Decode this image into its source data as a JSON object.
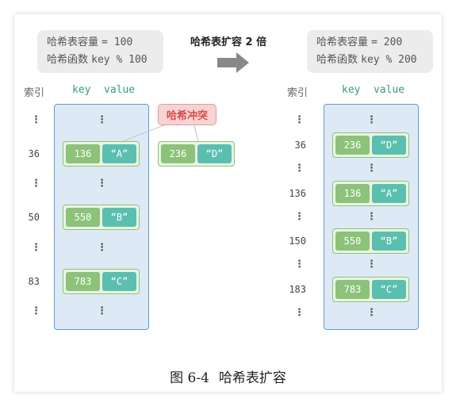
{
  "left_info": {
    "line1_label": "哈希表容量",
    "line1_value": "= 100",
    "line2_label": "哈希函数",
    "line2_value": "key % 100"
  },
  "right_info": {
    "line1_label": "哈希表容量",
    "line1_value": "= 200",
    "line2_label": "哈希函数",
    "line2_value": "key % 200"
  },
  "expand_label": "哈希表扩容 2 倍",
  "headers": {
    "index": "索引",
    "key": "key",
    "value": "value"
  },
  "collision_label": "哈希冲突",
  "left_table": {
    "indices": [
      "36",
      "50",
      "83"
    ],
    "pairs": [
      {
        "key": "136",
        "value": "“A”"
      },
      {
        "key": "550",
        "value": "“B”"
      },
      {
        "key": "783",
        "value": "“C”"
      }
    ]
  },
  "collision_pair": {
    "key": "236",
    "value": "“D”"
  },
  "right_table": {
    "indices": [
      "36",
      "136",
      "150",
      "183"
    ],
    "pairs": [
      {
        "key": "236",
        "value": "“D”"
      },
      {
        "key": "136",
        "value": "“A”"
      },
      {
        "key": "550",
        "value": "“B”"
      },
      {
        "key": "783",
        "value": "“C”"
      }
    ]
  },
  "caption": {
    "figure": "图 6-4",
    "text": "哈希表扩容"
  },
  "colors": {
    "table_border": "#5b9bd5",
    "table_fill": "#dde9f5",
    "key_fill": "#8dc27a",
    "value_fill": "#5bbfb0",
    "collision": "#d84a4a",
    "column_header": "#3d9a7a"
  }
}
